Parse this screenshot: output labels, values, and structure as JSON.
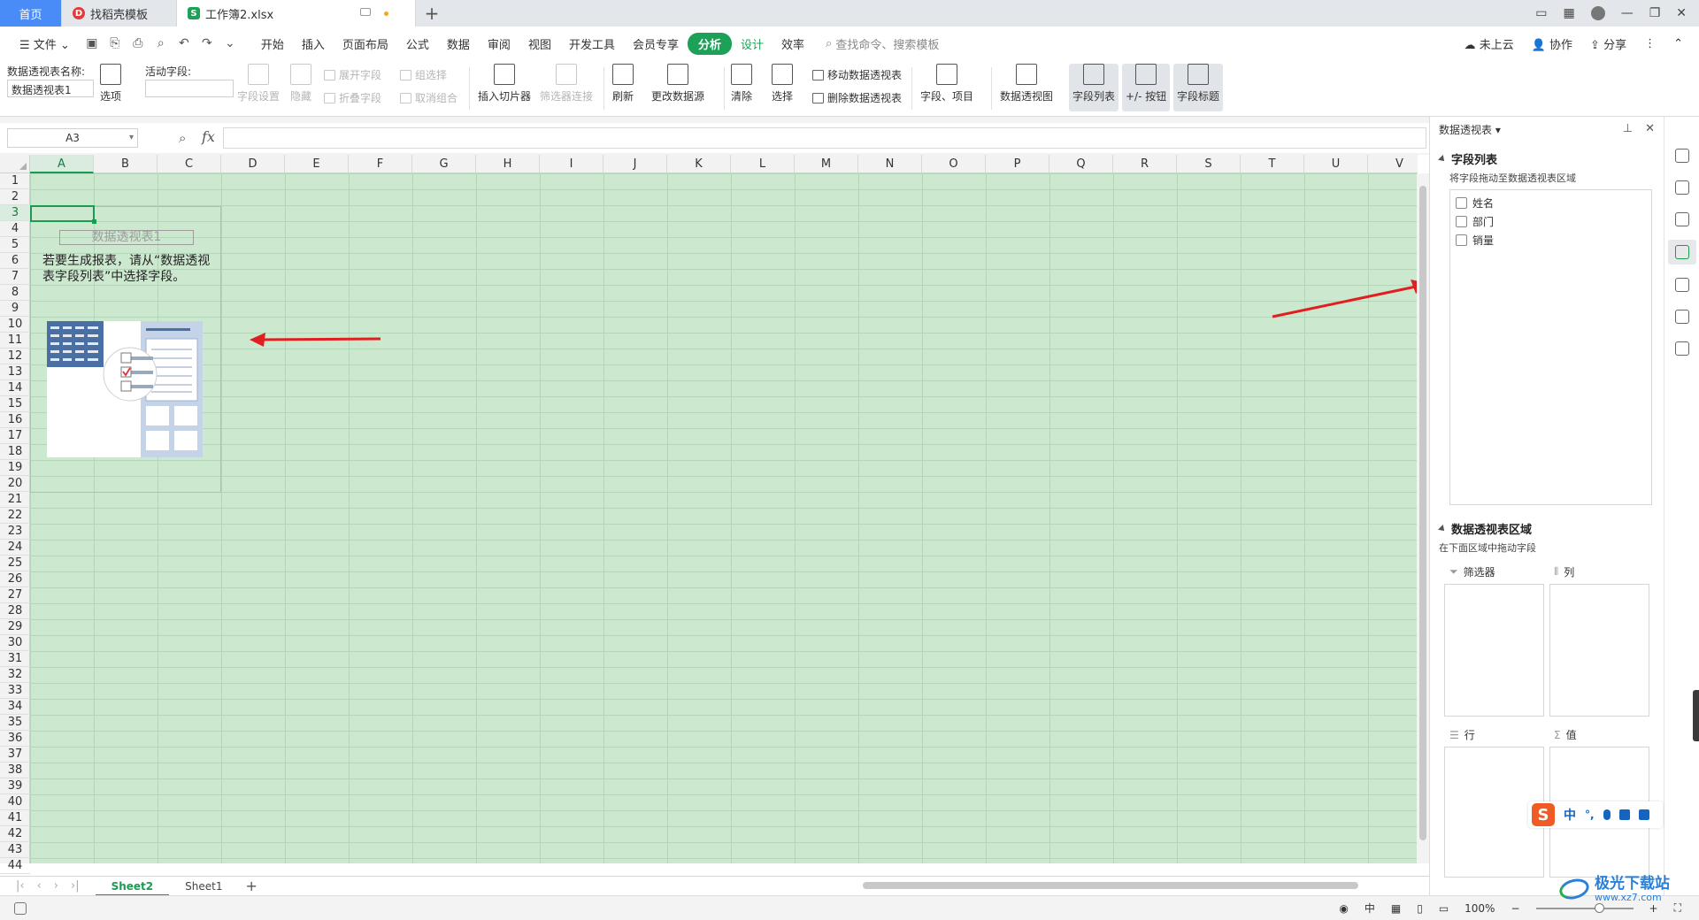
{
  "tabs": {
    "home": "首页",
    "template": "找稻壳模板",
    "active": "工作簿2.xlsx",
    "new": "+"
  },
  "menubar": {
    "file": "文件",
    "items": [
      "开始",
      "插入",
      "页面布局",
      "公式",
      "数据",
      "审阅",
      "视图",
      "开发工具",
      "会员专享"
    ],
    "analyze": "分析",
    "design": "设计",
    "efficiency": "效率",
    "search_placeholder": "查找命令、搜索模板",
    "cloud": "未上云",
    "collab": "协作",
    "share": "分享"
  },
  "ribbon": {
    "pivot_name_label": "数据透视表名称:",
    "pivot_name_value": "数据透视表1",
    "options": "选项",
    "active_field_label": "活动字段:",
    "field_settings": "字段设置",
    "expand_field": "展开字段",
    "collapse_field": "折叠字段",
    "hide": "隐藏",
    "group_selection": "组选择",
    "ungroup": "取消组合",
    "insert_slicer": "插入切片器",
    "filter_connections": "筛选器连接",
    "refresh": "刷新",
    "change_source": "更改数据源",
    "clear": "清除",
    "select": "选择",
    "move_pivot": "移动数据透视表",
    "delete_pivot": "删除数据透视表",
    "fields_items": "字段、项目",
    "pivot_chart": "数据透视图",
    "field_list": "字段列表",
    "buttons": "+/- 按钮",
    "field_headers": "字段标题"
  },
  "formula": {
    "cell_ref": "A3",
    "fx": "fx",
    "value": ""
  },
  "sheet": {
    "columns": [
      "A",
      "B",
      "C",
      "D",
      "E",
      "F",
      "G",
      "H",
      "I",
      "J",
      "K",
      "L",
      "M",
      "N",
      "O",
      "P",
      "Q",
      "R",
      "S",
      "T",
      "U",
      "V"
    ],
    "rows": [
      "1",
      "2",
      "3",
      "4",
      "5",
      "6",
      "7",
      "8",
      "9",
      "10",
      "11",
      "12",
      "13",
      "14",
      "15",
      "16",
      "17",
      "18",
      "19",
      "20",
      "21",
      "22",
      "23",
      "24",
      "25",
      "26",
      "27",
      "28",
      "29",
      "30",
      "31",
      "32",
      "33",
      "34",
      "35",
      "36",
      "37",
      "38",
      "39",
      "40",
      "41",
      "42",
      "43",
      "44"
    ],
    "active_col": "A",
    "active_row": "3",
    "pivot_placeholder_title": "数据透视表1",
    "pivot_placeholder_hint": "若要生成报表，请从“数据透视表字段列表”中选择字段。",
    "tabs": [
      "Sheet2",
      "Sheet1"
    ],
    "active_tab": "Sheet2"
  },
  "taskpane": {
    "title": "数据透视表",
    "field_list_title": "字段列表",
    "field_list_sub": "将字段拖动至数据透视表区域",
    "fields": [
      "姓名",
      "部门",
      "销量"
    ],
    "area_title": "数据透视表区域",
    "area_sub": "在下面区域中拖动字段",
    "filters": "筛选器",
    "columns": "列",
    "rows": "行",
    "values": "值"
  },
  "statusbar": {
    "lang": "中",
    "zoom": "100%"
  },
  "ime": {
    "lang": "中",
    "punct": "°,"
  },
  "watermark": {
    "text": "极光下载站",
    "url": "www.xz7.com"
  },
  "colors": {
    "accent_green": "#1da158",
    "cell_bg": "#cce8cf",
    "home_tab": "#4a8cf7",
    "arrow_red": "#e02020"
  }
}
